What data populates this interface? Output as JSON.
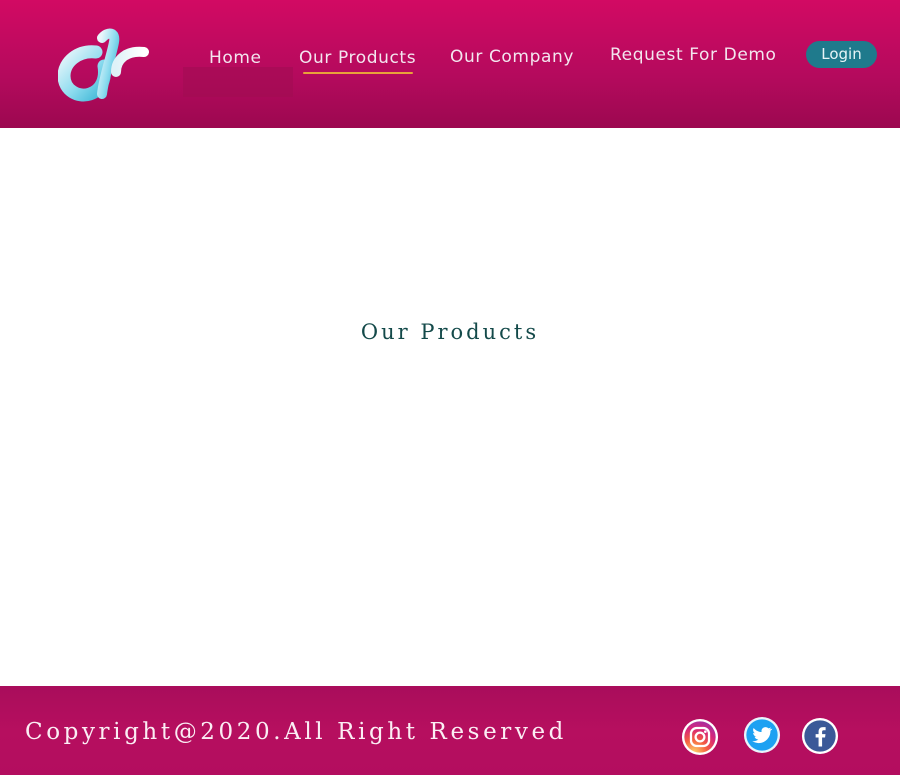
{
  "nav": {
    "items": [
      {
        "label": "Home"
      },
      {
        "label": "Our Products"
      },
      {
        "label": "Our Company"
      },
      {
        "label": "Request For Demo"
      }
    ],
    "login_label": "Login",
    "active_item": "Our Products"
  },
  "main": {
    "title": "Our Products"
  },
  "footer": {
    "copyright": "Copyright@2020.All Right Reserved",
    "social": [
      "instagram-icon",
      "twitter-icon",
      "facebook-icon"
    ]
  },
  "colors": {
    "header_bg": "#c40a60",
    "accent_underline": "#e8a23a",
    "login_bg": "#1f7a8c",
    "title_text": "#144a4a",
    "footer_bg": "#b00d5d"
  }
}
